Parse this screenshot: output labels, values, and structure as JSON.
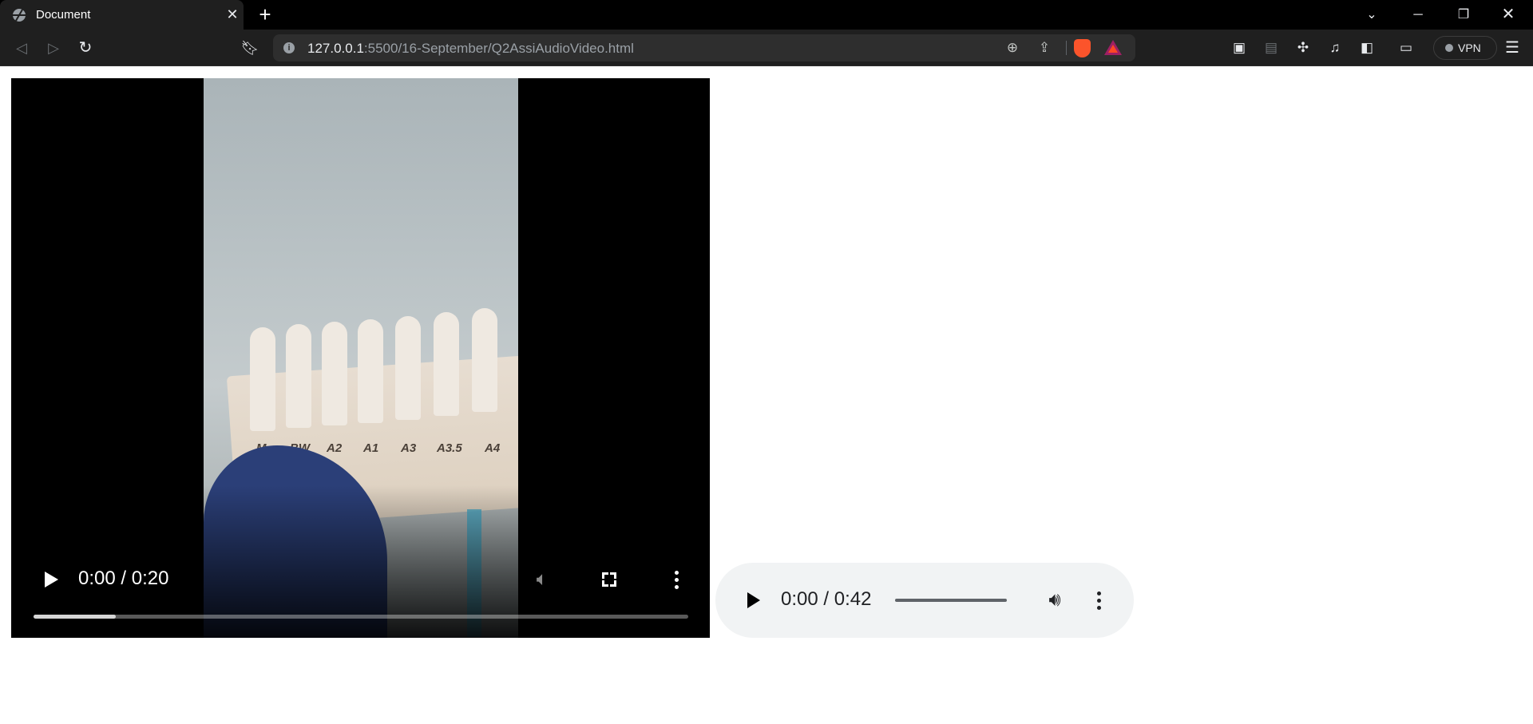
{
  "browser": {
    "tab": {
      "title": "Document",
      "favicon": "globe-icon"
    },
    "url": {
      "host": "127.0.0.1",
      "path": ":5500/16-September/Q2AssiAudioVideo.html"
    },
    "vpn_label": "VPN"
  },
  "video": {
    "time_display": "0:00 / 0:20",
    "progress_fraction": 0.125,
    "muted": true,
    "frame_labels": [
      "M",
      "BW",
      "A2",
      "A1",
      "A3",
      "A3.5",
      "A4"
    ]
  },
  "audio": {
    "time_display": "0:00 / 0:42",
    "progress_fraction": 0.0
  },
  "colors": {
    "chrome_bg": "#000000",
    "toolbar_bg": "#1f1f1f",
    "omnibox_bg": "#2e2e2e",
    "audio_bg": "#f1f3f4"
  }
}
